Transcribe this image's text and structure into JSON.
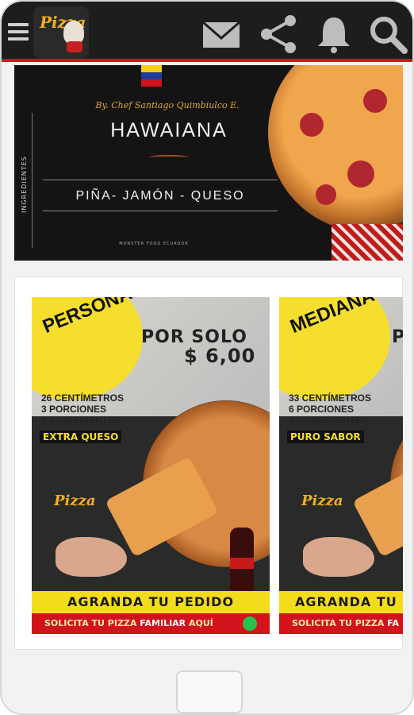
{
  "app": {
    "logo_text": "Pizza",
    "icons": [
      "menu-icon",
      "mail-icon",
      "share-icon",
      "bell-icon",
      "search-icon"
    ],
    "accent": "#d3121b"
  },
  "hero": {
    "chef_line": "By. Chef Santiago Quimbiulco E.",
    "title": "HAWAIANA",
    "ingredients": "PIÑA- JAMÓN - QUESO",
    "side_label": "INGREDIENTES",
    "footer": "MONSTER FOOD ECUADOR"
  },
  "promos": [
    {
      "size": "PERSONAL",
      "price_line1": "POR SOLO",
      "price_line2": "$ 6,00",
      "specs": [
        "26 CENTÍMETROS",
        "3 PORCIONES",
        "2 INGREDIENTES"
      ],
      "extra": "EXTRA QUESO",
      "logo": "Pizza",
      "order": "AGRANDA TU PEDIDO",
      "cta_pre": "SOLICITA TU PIZZA",
      "cta_bold": "FAMILIAR",
      "cta_post": "AQUÍ"
    },
    {
      "size": "MEDIANA",
      "price_line1": "P",
      "price_line2": "",
      "specs": [
        "33 CENTÍMETROS",
        "6 PORCIONES",
        "2 INGREDIENTES"
      ],
      "extra": "PURO SABOR",
      "logo": "Pizza",
      "order": "AGRANDA TU P",
      "cta_pre": "SOLICITA TU PIZZA",
      "cta_bold": "FA",
      "cta_post": ""
    }
  ]
}
